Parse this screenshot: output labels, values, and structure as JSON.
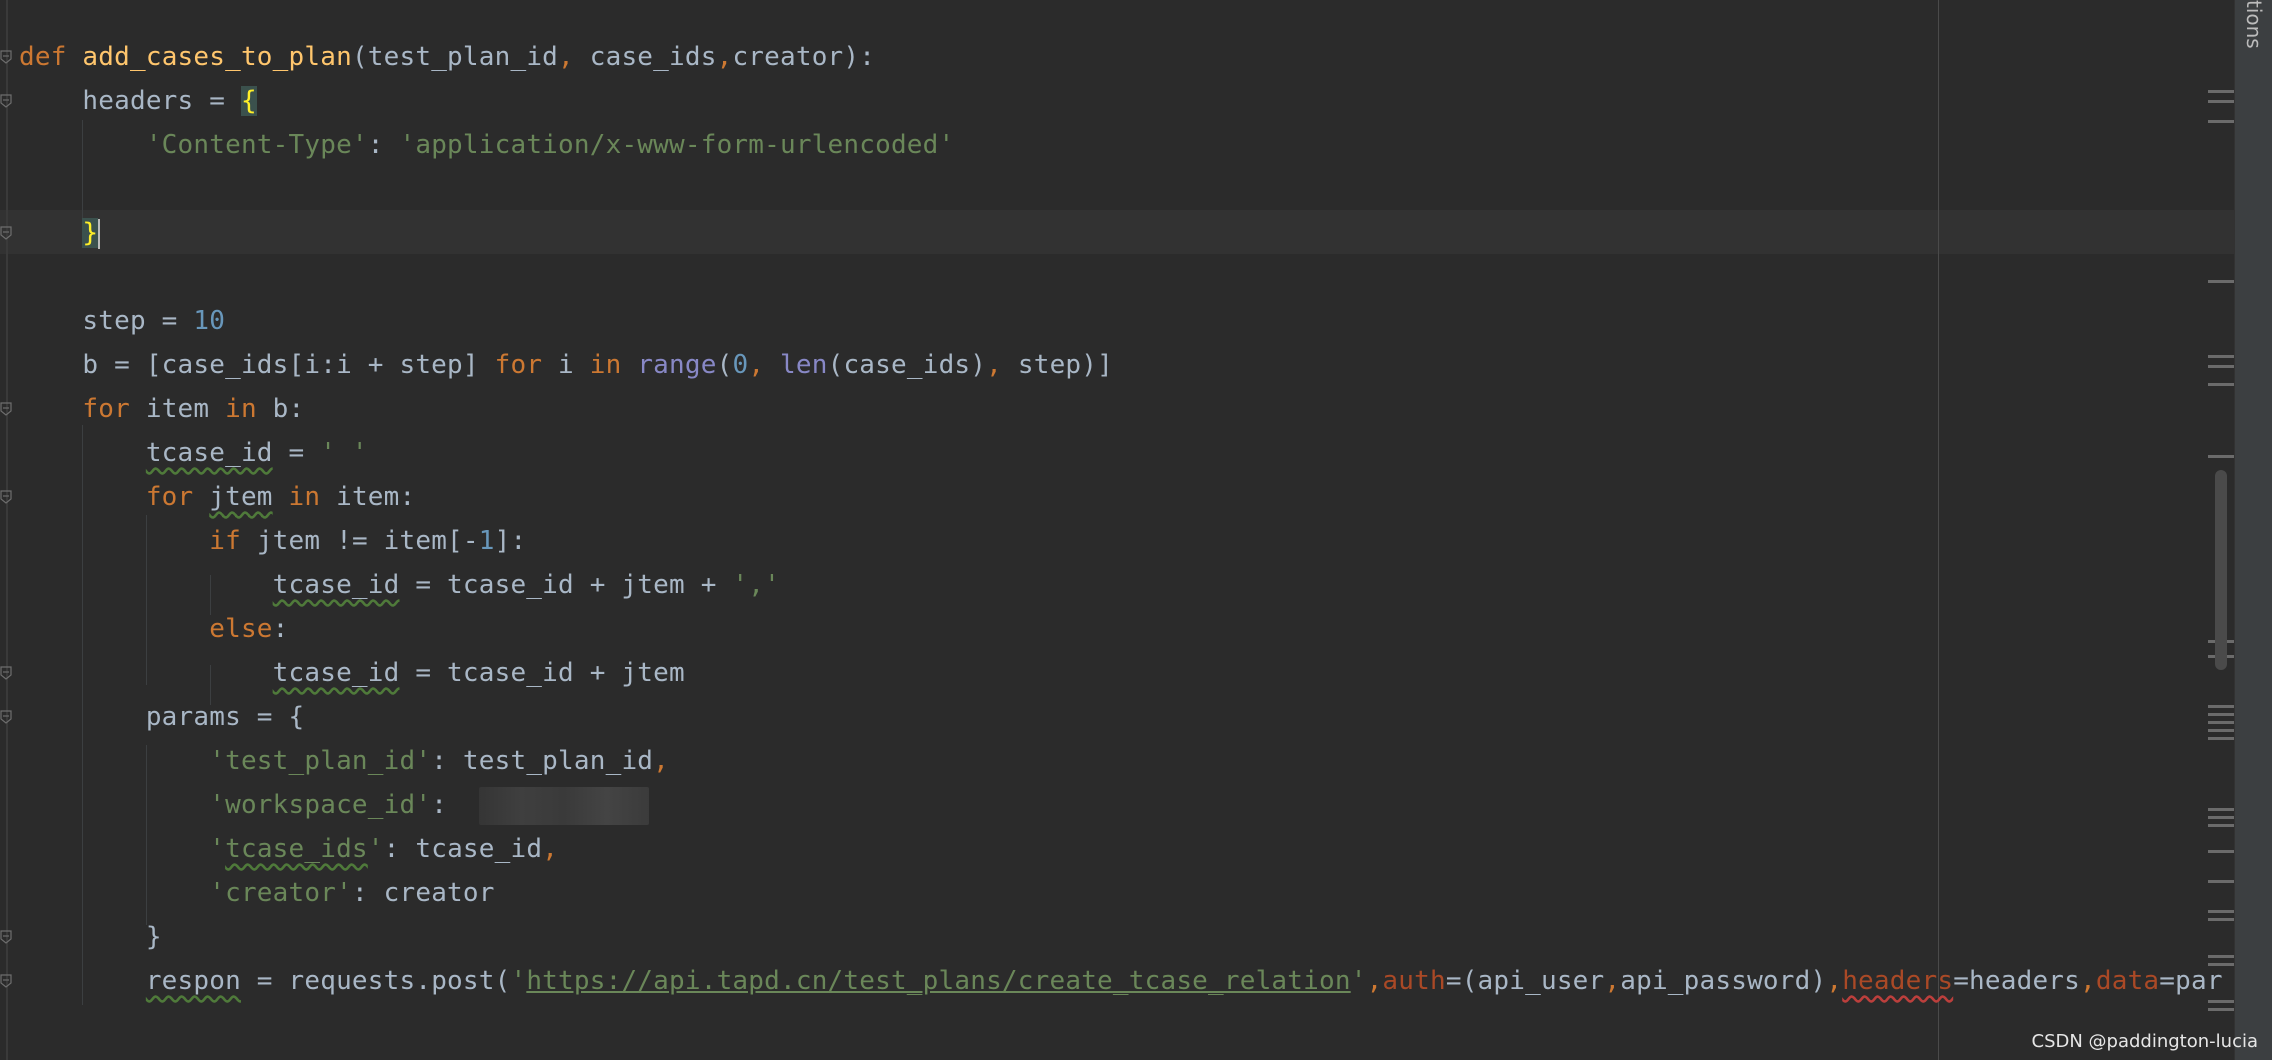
{
  "editor": {
    "lines": [
      {
        "segs": [
          [
            "kw",
            "def "
          ],
          [
            "fn",
            "add_cases_to_plan"
          ],
          [
            "",
            "(test_plan_id"
          ],
          [
            "kw",
            ", "
          ],
          [
            "",
            "case_ids"
          ],
          [
            "kw",
            ","
          ],
          [
            "",
            "creator):"
          ]
        ]
      },
      {
        "segs": [
          [
            "",
            "    headers = "
          ],
          [
            "brace",
            "{"
          ]
        ]
      },
      {
        "segs": [
          [
            "",
            "        "
          ],
          [
            "str",
            "'Content-Type'"
          ],
          [
            "",
            ": "
          ],
          [
            "str",
            "'application/x-www-form-urlencoded'"
          ]
        ]
      },
      {
        "segs": []
      },
      {
        "segs": [
          [
            "",
            "    "
          ],
          [
            "brace",
            "}"
          ],
          [
            "caret",
            ""
          ]
        ]
      },
      {
        "segs": []
      },
      {
        "segs": [
          [
            "",
            "    step = "
          ],
          [
            "num",
            "10"
          ]
        ]
      },
      {
        "segs": [
          [
            "",
            "    b = [case_ids[i:i + step] "
          ],
          [
            "kw",
            "for"
          ],
          [
            "",
            " i "
          ],
          [
            "kw",
            "in"
          ],
          [
            "",
            " "
          ],
          [
            "bi",
            "range"
          ],
          [
            "",
            "("
          ],
          [
            "num",
            "0"
          ],
          [
            "kw",
            ", "
          ],
          [
            "bi",
            "len"
          ],
          [
            "",
            "(case_ids)"
          ],
          [
            "kw",
            ", "
          ],
          [
            "",
            "step)]"
          ]
        ]
      },
      {
        "segs": [
          [
            "",
            "    "
          ],
          [
            "kw",
            "for"
          ],
          [
            "",
            " item "
          ],
          [
            "kw",
            "in"
          ],
          [
            "",
            " b:"
          ]
        ]
      },
      {
        "segs": [
          [
            "",
            "        "
          ],
          [
            "squig",
            "tcase_id"
          ],
          [
            "",
            " = "
          ],
          [
            "str",
            "' '"
          ]
        ]
      },
      {
        "segs": [
          [
            "",
            "        "
          ],
          [
            "kw",
            "for"
          ],
          [
            "",
            " "
          ],
          [
            "squig",
            "jtem"
          ],
          [
            "",
            " "
          ],
          [
            "kw",
            "in"
          ],
          [
            "",
            " item:"
          ]
        ]
      },
      {
        "segs": [
          [
            "",
            "            "
          ],
          [
            "kw",
            "if"
          ],
          [
            "",
            " jtem != item[-"
          ],
          [
            "num",
            "1"
          ],
          [
            "",
            "]:"
          ]
        ]
      },
      {
        "segs": [
          [
            "",
            "                "
          ],
          [
            "squig",
            "tcase_id"
          ],
          [
            "",
            " = tcase_id + jtem + "
          ],
          [
            "str",
            "','"
          ]
        ]
      },
      {
        "segs": [
          [
            "",
            "            "
          ],
          [
            "kw",
            "else"
          ],
          [
            "",
            ":"
          ]
        ]
      },
      {
        "segs": [
          [
            "",
            "                "
          ],
          [
            "squig",
            "tcase_id"
          ],
          [
            "",
            " = tcase_id + jtem"
          ]
        ]
      },
      {
        "segs": [
          [
            "",
            "        params = {"
          ]
        ]
      },
      {
        "segs": [
          [
            "",
            "            "
          ],
          [
            "str",
            "'test_plan_id'"
          ],
          [
            "",
            ": test_plan_id"
          ],
          [
            "kw",
            ","
          ]
        ]
      },
      {
        "segs": [
          [
            "",
            "            "
          ],
          [
            "str",
            "'workspace_id'"
          ],
          [
            "",
            ":  "
          ],
          [
            "blurred",
            ""
          ]
        ]
      },
      {
        "segs": [
          [
            "",
            "            "
          ],
          [
            "str",
            "'"
          ],
          [
            "squigstr",
            "tcase_ids"
          ],
          [
            "str",
            "'"
          ],
          [
            "",
            ": tcase_id"
          ],
          [
            "kw",
            ","
          ]
        ]
      },
      {
        "segs": [
          [
            "",
            "            "
          ],
          [
            "str",
            "'creator'"
          ],
          [
            "",
            ": creator"
          ]
        ]
      },
      {
        "segs": [
          [
            "",
            "        }"
          ]
        ]
      },
      {
        "segs": [
          [
            "",
            "        "
          ],
          [
            "squig",
            "respon"
          ],
          [
            "",
            " = requests.post("
          ],
          [
            "str",
            "'"
          ],
          [
            "url",
            "https://api.tapd.cn/test_plans/create_tcase_relation"
          ],
          [
            "str",
            "'"
          ],
          [
            "kw",
            ","
          ],
          [
            "param",
            "auth"
          ],
          [
            "",
            "=(api_user"
          ],
          [
            "kw",
            ","
          ],
          [
            "",
            "api_password)"
          ],
          [
            "kw",
            ","
          ],
          [
            "paramsq",
            "headers"
          ],
          [
            "",
            "=headers"
          ],
          [
            "kw",
            ","
          ],
          [
            "param",
            "data"
          ],
          [
            "",
            "=par"
          ]
        ]
      }
    ]
  },
  "sidebar": {
    "tab_label": "tions"
  },
  "watermark": "CSDN @paddington-lucia"
}
